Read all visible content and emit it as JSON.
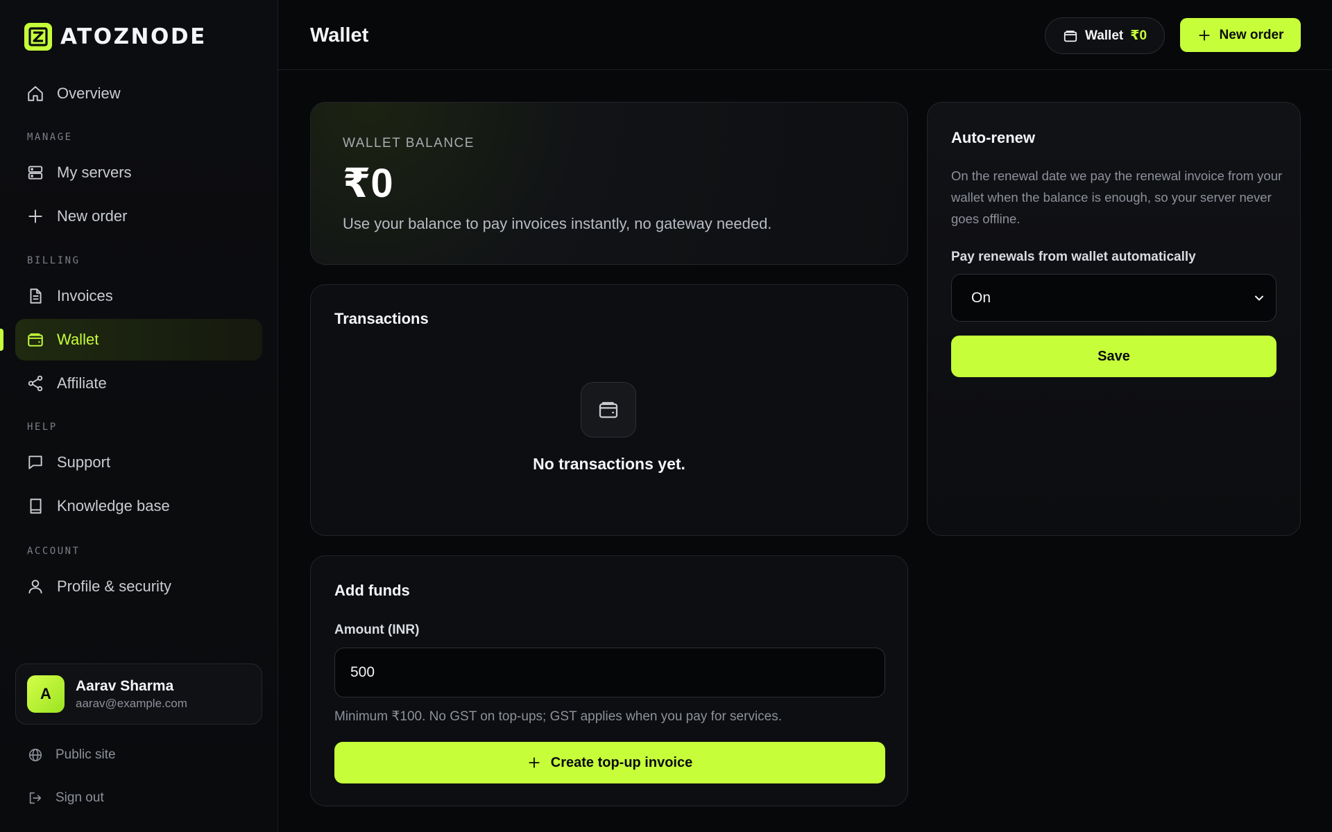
{
  "brand": {
    "name": "ATOZNODE",
    "accent": "#c6ff3a"
  },
  "sidebar": {
    "overview": "Overview",
    "sections": {
      "manage": "MANAGE",
      "billing": "BILLING",
      "help": "HELP",
      "account": "ACCOUNT"
    },
    "items": {
      "my_servers": "My servers",
      "new_order": "New order",
      "invoices": "Invoices",
      "wallet": "Wallet",
      "affiliate": "Affiliate",
      "support": "Support",
      "knowledge_base": "Knowledge base",
      "profile_security": "Profile & security"
    },
    "active": "wallet"
  },
  "user": {
    "initial": "A",
    "name": "Aarav Sharma",
    "email": "aarav@example.com"
  },
  "footer": {
    "public_site": "Public site",
    "sign_out": "Sign out"
  },
  "header": {
    "title": "Wallet",
    "wallet_label": "Wallet",
    "wallet_amount": "₹0",
    "new_order": "New order"
  },
  "balance": {
    "label": "WALLET BALANCE",
    "value": "₹0",
    "description": "Use your balance to pay invoices instantly, no gateway needed."
  },
  "transactions": {
    "title": "Transactions",
    "empty": "No transactions yet."
  },
  "add_funds": {
    "title": "Add funds",
    "amount_label": "Amount (INR)",
    "amount_value": "500",
    "hint": "Minimum ₹100. No GST on top-ups; GST applies when you pay for services.",
    "button": "Create top-up invoice"
  },
  "auto_renew": {
    "title": "Auto-renew",
    "description": "On the renewal date we pay the renewal invoice from your wallet when the balance is enough, so your server never goes offline.",
    "select_label": "Pay renewals from wallet automatically",
    "select_value": "On",
    "save": "Save"
  }
}
